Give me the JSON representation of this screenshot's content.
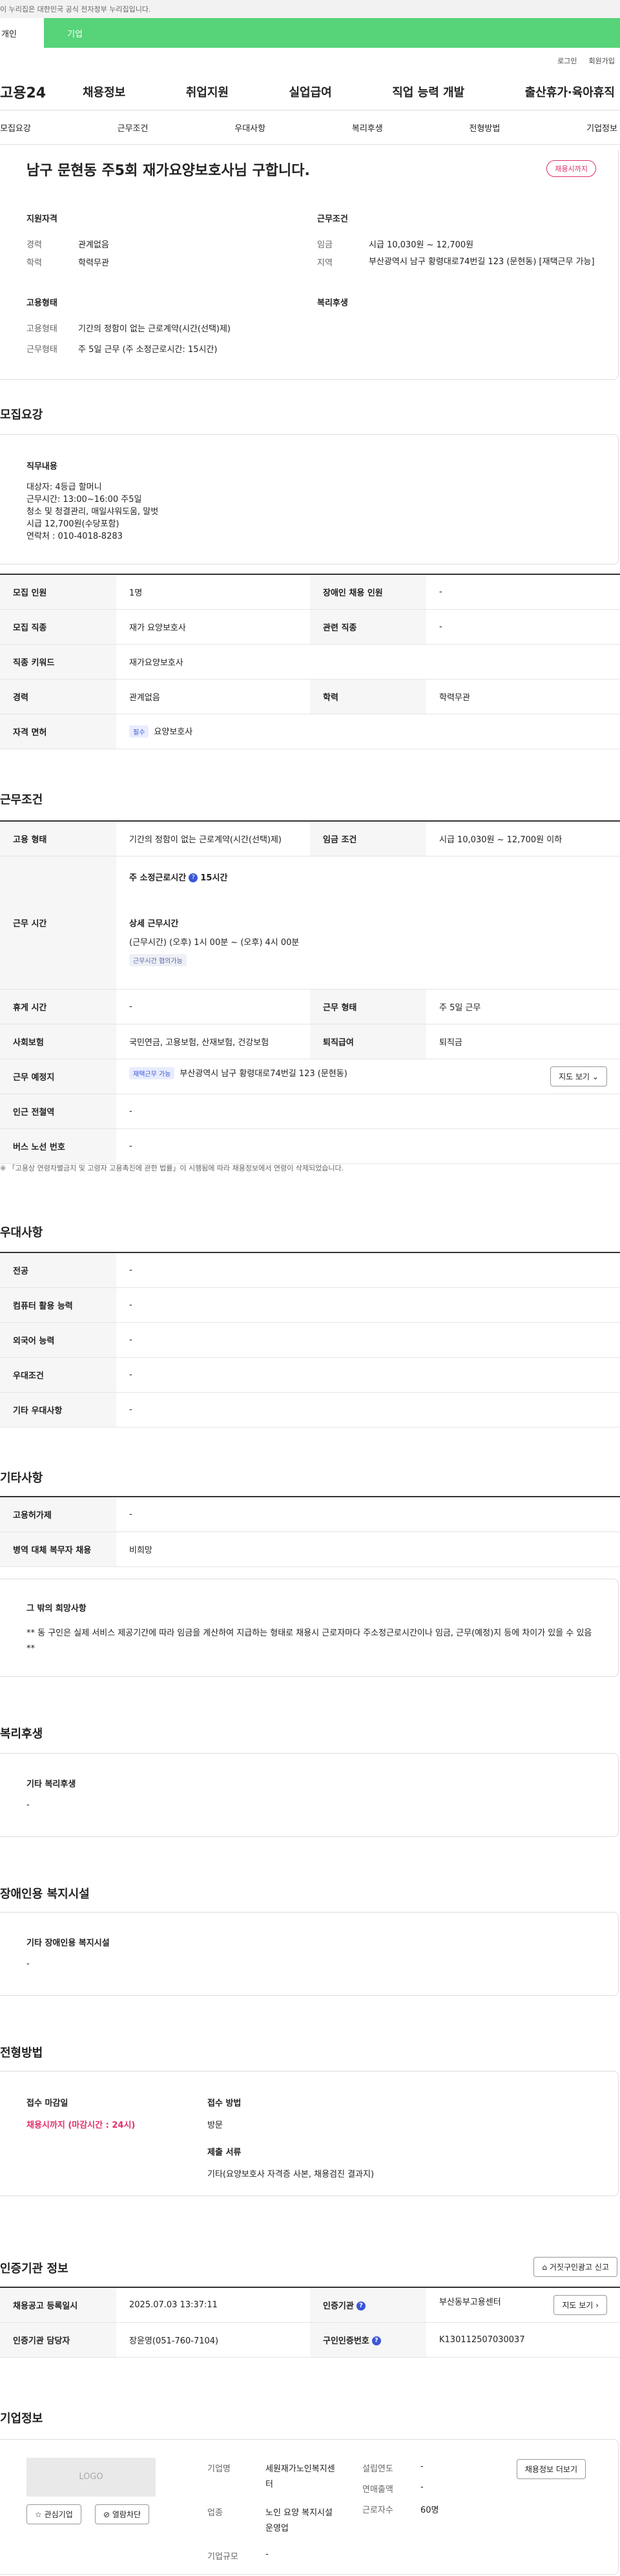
{
  "banner": "이 누리집은 대한민국 공식 전자정부 누리집입니다.",
  "top_tabs": [
    "개인",
    "기업"
  ],
  "util": [
    "로그인",
    "회원가입"
  ],
  "logo": "고용24",
  "gnb": [
    "채용정보",
    "취업지원",
    "실업급여",
    "직업 능력 개발",
    "출산휴가·육아휴직"
  ],
  "subnav": [
    "모집요강",
    "근무조건",
    "우대사항",
    "복리후생",
    "전형방법",
    "기업정보"
  ],
  "headline": {
    "title": "남구 문현동 주5회 재가요양보호사님 구합니다.",
    "badge": "채용시까지",
    "qual_title": "지원자격",
    "qual": [
      {
        "label": "경력",
        "value": "관계없음"
      },
      {
        "label": "학력",
        "value": "학력무관"
      }
    ],
    "cond_title": "근무조건",
    "cond": [
      {
        "label": "임금",
        "value": "시급 10,030원 ~ 12,700원"
      },
      {
        "label": "지역",
        "value": "부산광역시 남구 황령대로74번길 123 (문현동) [재택근무 가능]"
      }
    ],
    "emp_title": "고용형태",
    "emp": [
      {
        "label": "고용형태",
        "value": "기간의 정함이 없는 근로계약(시간(선택)제)"
      },
      {
        "label": "근무형태",
        "value": "주 5일 근무 (주 소정근로시간: 15시간)"
      }
    ],
    "welfare_title": "복리후생"
  },
  "recruit": {
    "title": "모집요강",
    "duty_title": "직무내용",
    "duty_lines": [
      "대상자: 4등급 할머니",
      "근무시간: 13:00~16:00 주5일",
      "청소 및 청결관리, 매일샤워도움, 말벗",
      "시급 12,700원(수당포함)",
      "연락처 : 010-4018-8283"
    ],
    "rows": [
      {
        "k1": "모집 인원",
        "v1": "1명",
        "k2": "장애인 채용 인원",
        "v2": "-"
      },
      {
        "k1": "모집 직종",
        "v1": "재가 요양보호사",
        "k2": "관련 직종",
        "v2": "-"
      },
      {
        "k1": "직종 키워드",
        "v1": "재가요양보호사"
      },
      {
        "k1": "경력",
        "v1": "관계없음",
        "k2": "학력",
        "v2": "학력무관"
      },
      {
        "k1": "자격 면허",
        "chip": "필수",
        "v1": "요양보호사"
      }
    ]
  },
  "work": {
    "title": "근무조건",
    "emp_type_k": "고용 형태",
    "emp_type_v": "기간의 정함이 없는 근로계약(시간(선택)제)",
    "wage_k": "임금 조건",
    "wage_v": "시급 10,030원 ~ 12,700원 이하",
    "time_k": "근무 시간",
    "time_std": "주 소정근로시간",
    "time_std_v": "15시간",
    "time_detail_t": "상세 근무시간",
    "time_detail_v": "(근무시간) (오후) 1시 00분 ~ (오후) 4시 00분",
    "time_chip": "근무시간 협의가능",
    "rest_k": "휴게 시간",
    "rest_v": "-",
    "form_k": "근무 형태",
    "form_v": "주 5일 근무",
    "ins_k": "사회보험",
    "ins_v": "국민연금, 고용보험, 산재보험, 건강보험",
    "ret_k": "퇴직급여",
    "ret_v": "퇴직금",
    "place_k": "근무 예정지",
    "place_chip": "재택근무 가능",
    "place_v": "부산광역시 남구 황령대로74번길 123 (문현동)",
    "map_btn": "지도 보기",
    "station_k": "인근 전철역",
    "station_v": "-",
    "bus_k": "버스 노선 번호",
    "bus_v": "-",
    "note": "※ 「고용상 연령차별금지 및 고령자 고용촉진에 관한 법률」이 시행됨에 따라 채용정보에서 연령이 삭제되었습니다."
  },
  "pref": {
    "title": "우대사항",
    "rows": [
      {
        "k": "전공",
        "v": "-"
      },
      {
        "k": "컴퓨터 활용 능력",
        "v": "-"
      },
      {
        "k": "외국어 능력",
        "v": "-"
      },
      {
        "k": "우대조건",
        "v": "-"
      },
      {
        "k": "기타 우대사항",
        "v": "-"
      }
    ]
  },
  "etc": {
    "title": "기타사항",
    "rows": [
      {
        "k": "고용허가제",
        "v": "-"
      },
      {
        "k": "병역 대체 복무자 채용",
        "v": "비희망"
      }
    ],
    "box_title": "그 밖의 희망사항",
    "box_text": "** 동 구인은 실제 서비스 제공기간에 따라 임금을 계산하여 지급하는 형태로 채용시 근로자마다 주소정근로시간이나 임금, 근무(예정)지 등에 차이가 있을 수 있음 **"
  },
  "welfare": {
    "title": "복리후생",
    "box_title": "기타 복리후생",
    "box_value": "-"
  },
  "disabled": {
    "title": "장애인용 복지시설",
    "box_title": "기타 장애인용 복지시설",
    "box_value": "-"
  },
  "selection": {
    "title": "전형방법",
    "deadline_t": "접수 마감일",
    "deadline_v": "채용시까지 (마감시간 : 24시)",
    "method_t": "접수 방법",
    "method_v": "방문",
    "docs_t": "제출 서류",
    "docs_v": "기타(요양보호사 자격증 사본, 채용검진 결과지)"
  },
  "agency": {
    "title": "인증기관 정보",
    "report_btn": "거짓구인광고 신고",
    "reg_k": "채용공고 등록일시",
    "reg_v": "2025.07.03 13:37:11",
    "org_k": "인증기관",
    "org_v": "부산동부고용센터",
    "mgr_k": "인증기관 담당자",
    "mgr_v": "장윤영(051-760-7104)",
    "no_k": "구인인증번호",
    "no_v": "K130112507030037",
    "map_btn": "지도 보기"
  },
  "company": {
    "title": "기업정보",
    "logo": "LOGO",
    "fav_btn": "관심기업",
    "block_btn": "열람차단",
    "info_btn": "채용정보 더보기",
    "name_k": "기업명",
    "name_v": "세원재가노인복지센터",
    "year_k": "설립연도",
    "year_v": "-",
    "sales_k": "연매출액",
    "sales_v": "-",
    "biz_k": "업종",
    "biz_v": "노인 요양 복지시설 운영업",
    "emp_k": "근로자수",
    "emp_v": "60명",
    "size_k": "기업규모",
    "size_v": "-"
  }
}
